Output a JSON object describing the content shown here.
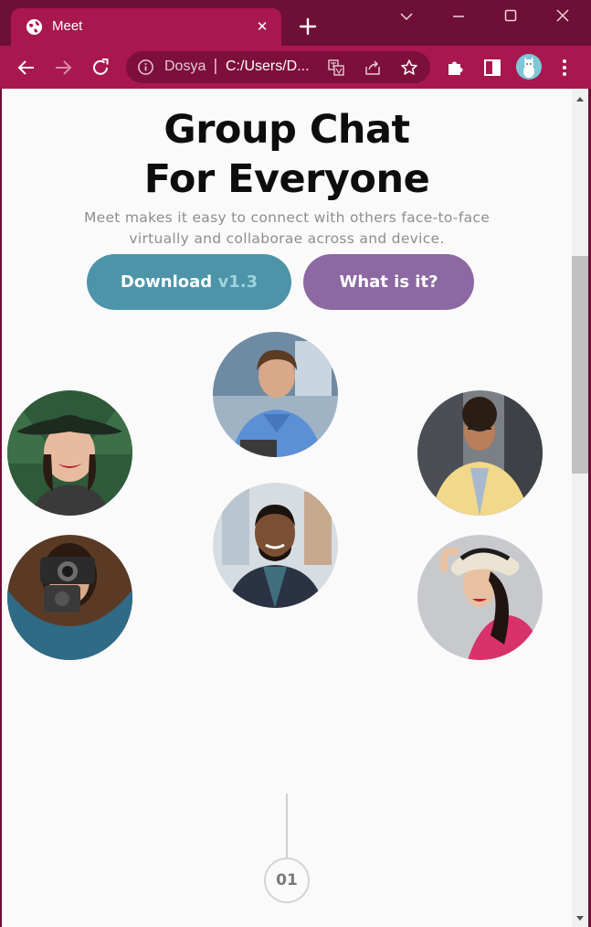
{
  "browser": {
    "tab_title": "Meet",
    "omnibox_site": "Dosya",
    "omnibox_url": "C:/Users/D...",
    "accent": "#a8184f",
    "frame": "#6e0f36"
  },
  "hero": {
    "title_line1": "Group Chat",
    "title_line2": "For Everyone",
    "subtitle_line1": "Meet makes it easy to connect with others face-to-face",
    "subtitle_line2": "virtually and collaborae across and device.",
    "download_label": "Download",
    "download_version": "v1.3",
    "what_label": "What is it?"
  },
  "colors": {
    "download_button": "#4d94a8",
    "what_button": "#8c69a2"
  },
  "timeline": {
    "step": "01"
  },
  "icons": [
    "globe-icon",
    "close-icon",
    "plus-icon",
    "chevron-down-icon",
    "minimize-icon",
    "maximize-icon",
    "back-icon",
    "forward-icon",
    "reload-icon",
    "info-icon",
    "translate-icon",
    "share-icon",
    "star-icon",
    "extensions-icon",
    "sidepanel-icon",
    "menu-icon"
  ]
}
